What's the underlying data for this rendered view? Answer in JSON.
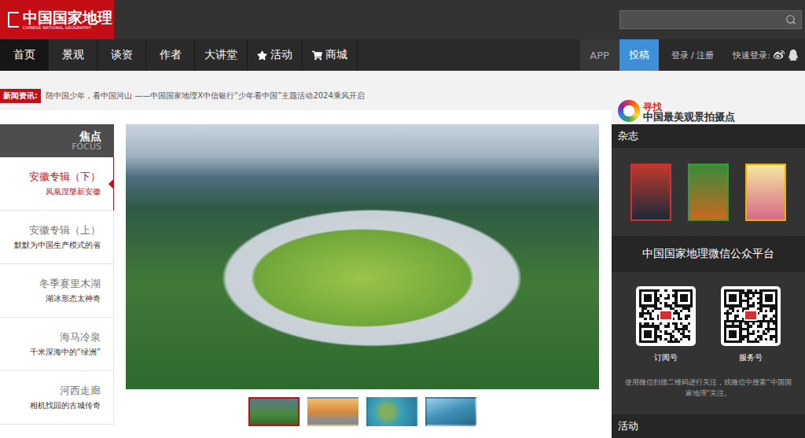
{
  "header": {
    "logo": {
      "title": "中国国家地理",
      "subtitle": "CHINESE NATIONAL GEOGRAPHY"
    },
    "search": {
      "placeholder": ""
    }
  },
  "nav": {
    "items": [
      {
        "label": "首页",
        "selected": true,
        "kind": "plain"
      },
      {
        "label": "景观",
        "selected": false,
        "kind": "plain"
      },
      {
        "label": "谈资",
        "selected": false,
        "kind": "plain"
      },
      {
        "label": "作者",
        "selected": false,
        "kind": "plain"
      },
      {
        "label": "大讲堂",
        "selected": false,
        "kind": "plain"
      },
      {
        "label": "活动",
        "selected": false,
        "kind": "star"
      },
      {
        "label": "商城",
        "selected": false,
        "kind": "cart"
      }
    ],
    "app": "APP",
    "submit": "投稿",
    "login": "登录 / 注册",
    "quick_login": "快速登录:"
  },
  "news": {
    "label": "新闻资讯:",
    "text": "陪中国少年，看中国河山 ——中国国家地理X中信银行“少年看中国”主题活动2024乘风开启"
  },
  "promo": {
    "top": "寻找",
    "bottom": "中国最美观景拍摄点"
  },
  "focus": {
    "title": "焦点",
    "subtitle": "FOCUS",
    "items": [
      {
        "title": "安徽专辑（下）",
        "subtitle": "凤凰涅槃新安徽",
        "selected": true
      },
      {
        "title": "安徽专辑（上）",
        "subtitle": "默默为中国生产模式的省",
        "selected": false
      },
      {
        "title": "冬季赛里木湖",
        "subtitle": "湖冰形态太神奇",
        "selected": false
      },
      {
        "title": "海马冷泉",
        "subtitle": "千米深海中的“绿洲”",
        "selected": false
      },
      {
        "title": "河西走廊",
        "subtitle": "相机找回的古城传奇",
        "selected": false
      }
    ]
  },
  "thumbnails": [
    {
      "selected": true
    },
    {
      "selected": false
    },
    {
      "selected": false
    },
    {
      "selected": false
    }
  ],
  "sidebar": {
    "magazines_title": "杂志",
    "wechat_title": "中国国家地理微信公众平台",
    "qr_codes": [
      {
        "label": "订阅号"
      },
      {
        "label": "服务号"
      }
    ],
    "wechat_note": "使用微信扫描二维码进行关注，或微信中搜索“中国国家地理”关注。",
    "activity_title": "活动"
  }
}
